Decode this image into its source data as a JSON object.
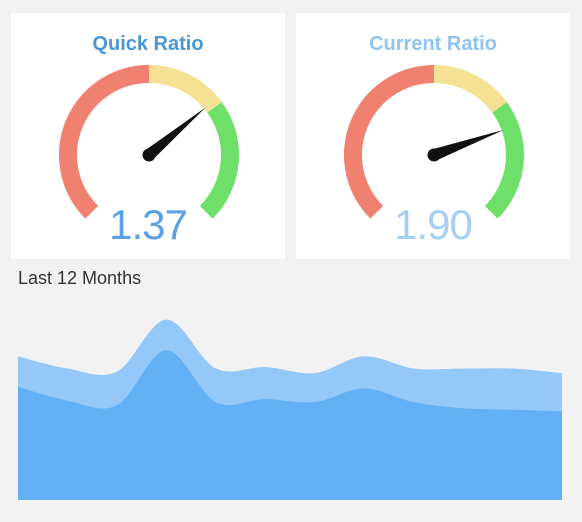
{
  "gauges": [
    {
      "title": "Quick Ratio",
      "value_label": "1.37",
      "needle_value": 1.37,
      "min": 0,
      "max": 2,
      "bands": [
        {
          "from": 0,
          "to": 1.0,
          "color": "#f08070"
        },
        {
          "from": 1.0,
          "to": 1.4,
          "color": "#f5e194"
        },
        {
          "from": 1.4,
          "to": 2.0,
          "color": "#6ee06a"
        }
      ],
      "title_color": "#4a97d4",
      "value_color": "#5ba3e6"
    },
    {
      "title": "Current Ratio",
      "value_label": "1.90",
      "needle_value": 1.9,
      "min": 0,
      "max": 2.5,
      "bands": [
        {
          "from": 0,
          "to": 1.25,
          "color": "#f08070"
        },
        {
          "from": 1.25,
          "to": 1.75,
          "color": "#f5e194"
        },
        {
          "from": 1.75,
          "to": 2.5,
          "color": "#6ee06a"
        }
      ],
      "title_color": "#8ec3f2",
      "value_color": "#a4cff5"
    }
  ],
  "section_title": "Last 12 Months",
  "chart_data": {
    "type": "area",
    "title": "Last 12 Months",
    "x": [
      1,
      2,
      3,
      4,
      5,
      6,
      7,
      8,
      9,
      10,
      11,
      12
    ],
    "series": [
      {
        "values": [
          74,
          65,
          62,
          98,
          64,
          66,
          64,
          73,
          64,
          60,
          59,
          58
        ],
        "color": "#63b0f5"
      },
      {
        "values": [
          20,
          21,
          22,
          20,
          22,
          21,
          19,
          21,
          22,
          26,
          27,
          25
        ],
        "color": "#94c8f8"
      }
    ],
    "stacked": true,
    "ylim": [
      0,
      140
    ],
    "grid": false,
    "axes_visible": false
  }
}
